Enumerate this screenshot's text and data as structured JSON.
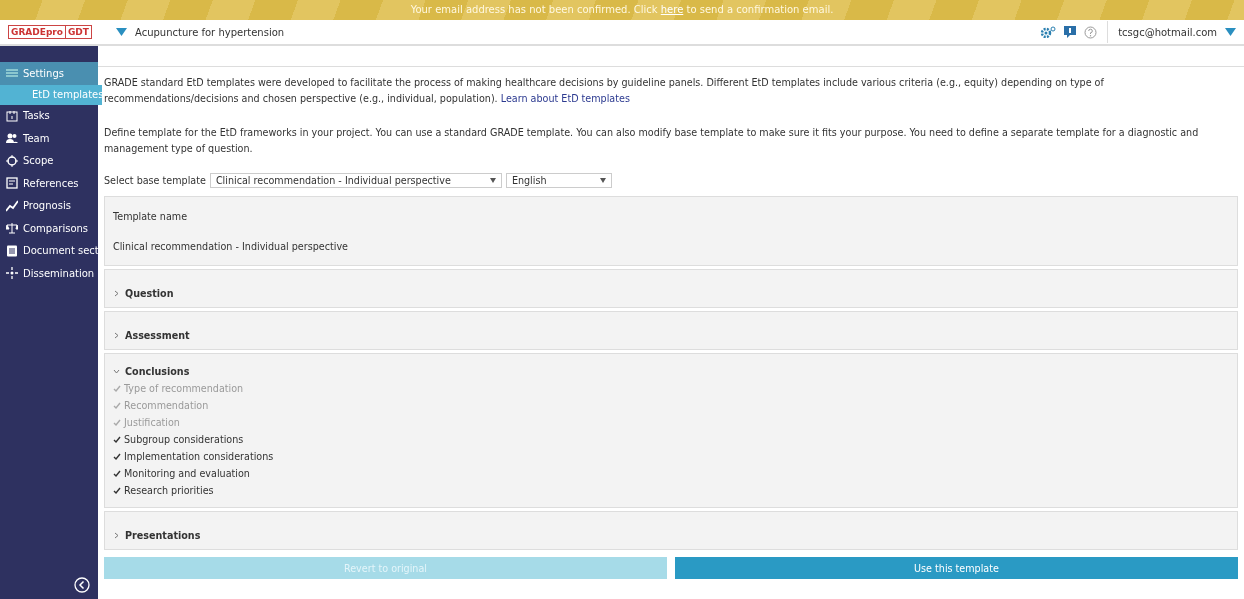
{
  "banner": {
    "before": "Your email address has not been confirmed. Click ",
    "link": "here",
    "after": " to send a confirmation email."
  },
  "header": {
    "logo_left": "GRADEpro",
    "logo_right": "GDT",
    "project": "Acupuncture for hypertension",
    "user": "tcsgc@hotmail.com"
  },
  "sidebar": {
    "items": [
      {
        "label": "Settings",
        "kind": "settings",
        "selected": false,
        "expanded": true,
        "children": [
          {
            "label": "EtD templates",
            "selected": true
          }
        ]
      },
      {
        "label": "Tasks",
        "kind": "tasks",
        "selected": false
      },
      {
        "label": "Team",
        "kind": "team",
        "selected": false
      },
      {
        "label": "Scope",
        "kind": "scope",
        "selected": false
      },
      {
        "label": "References",
        "kind": "references",
        "selected": false
      },
      {
        "label": "Prognosis",
        "kind": "prognosis",
        "selected": false
      },
      {
        "label": "Comparisons",
        "kind": "comparisons",
        "selected": false
      },
      {
        "label": "Document sect",
        "kind": "document",
        "selected": false
      },
      {
        "label": "Dissemination",
        "kind": "dissemination",
        "selected": false
      }
    ]
  },
  "intro": {
    "text": "GRADE standard EtD templates were developed to facilitate the process of making healthcare decisions by guideline panels. Different EtD templates include various criteria (e.g., equity) depending on type of recommendations/decisions and chosen perspective (e.g., individual, population).",
    "link": "Learn about EtD templates"
  },
  "description": "Define template for the EtD frameworks in your project. You can use a standard GRADE template. You can also modify base template to make sure it fits your purpose. You need to define a separate template for a diagnostic and management type of question.",
  "base_template": {
    "label": "Select base template",
    "template": "Clinical recommendation - Individual perspective",
    "language": "English"
  },
  "template_name": {
    "label": "Template name",
    "value": "Clinical recommendation - Individual perspective"
  },
  "sections": [
    {
      "title": "Question",
      "expanded": false
    },
    {
      "title": "Assessment",
      "expanded": false
    },
    {
      "title": "Conclusions",
      "expanded": true,
      "items": [
        {
          "label": "Type of recommendation",
          "checked": true,
          "disabled": true
        },
        {
          "label": "Recommendation",
          "checked": true,
          "disabled": true
        },
        {
          "label": "Justification",
          "checked": true,
          "disabled": true
        },
        {
          "label": "Subgroup considerations",
          "checked": true,
          "disabled": false
        },
        {
          "label": "Implementation considerations",
          "checked": true,
          "disabled": false
        },
        {
          "label": "Monitoring and evaluation",
          "checked": true,
          "disabled": false
        },
        {
          "label": "Research priorities",
          "checked": true,
          "disabled": false
        }
      ]
    },
    {
      "title": "Presentations",
      "expanded": false
    }
  ],
  "buttons": [
    {
      "label": "Revert to original",
      "disabled": true
    },
    {
      "label": "Use this template",
      "disabled": false
    }
  ]
}
